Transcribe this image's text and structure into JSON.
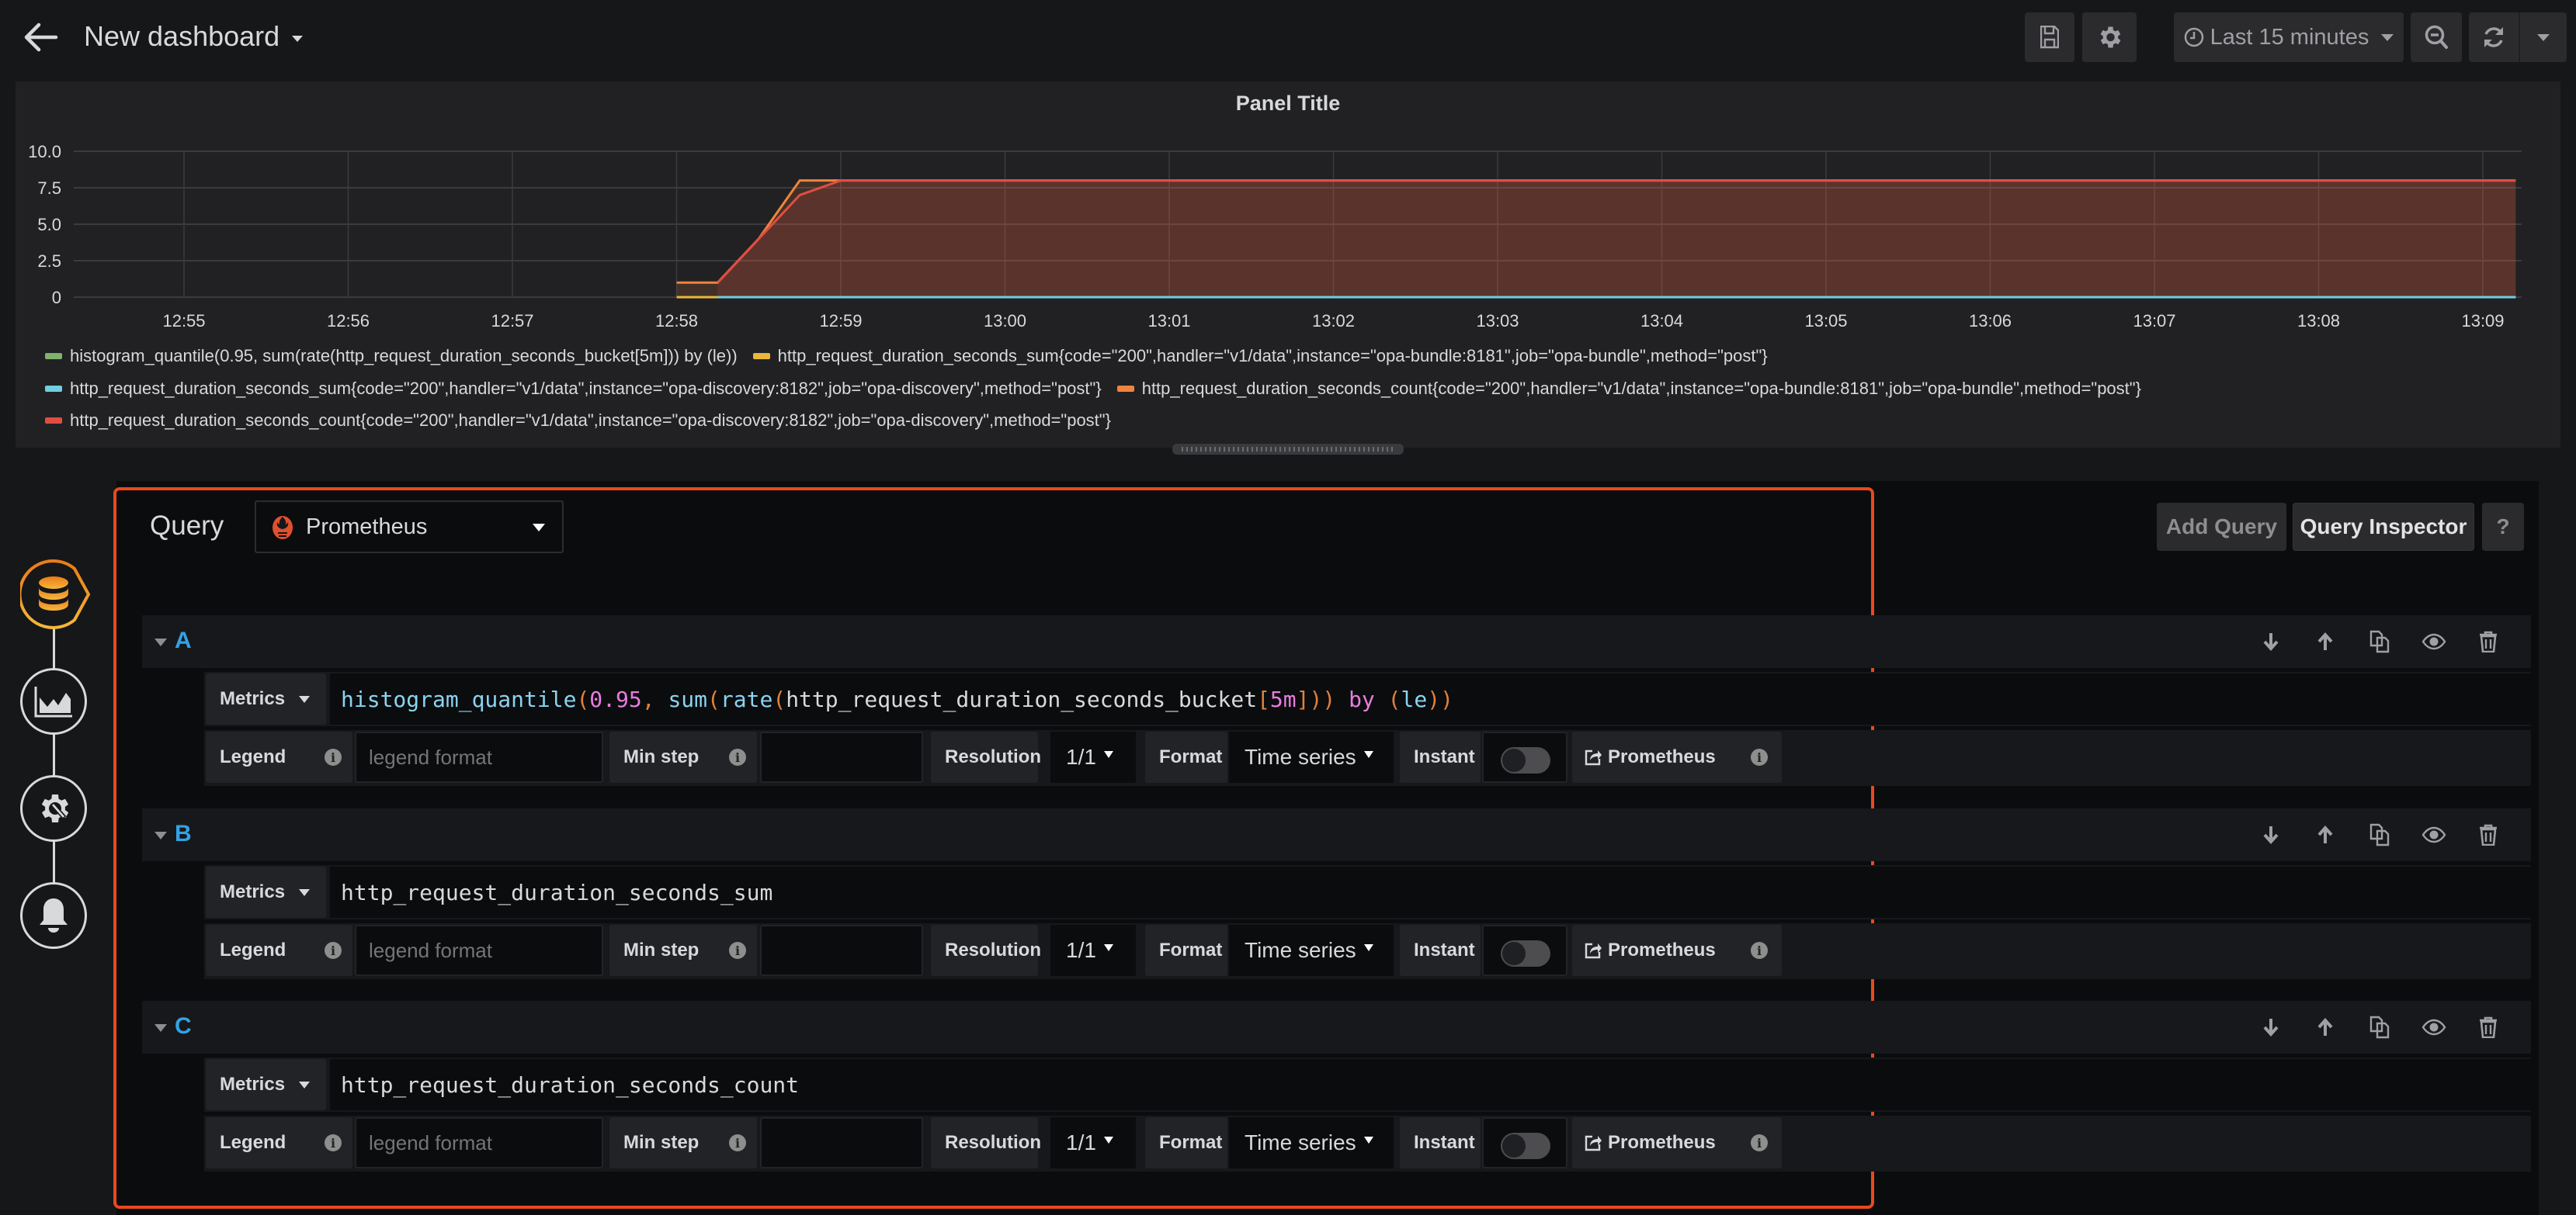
{
  "header": {
    "title": "New dashboard",
    "time_range": "Last 15 minutes",
    "icons": {
      "back": "arrow-left-icon",
      "save": "save-icon",
      "settings": "gear-icon",
      "clock": "clock-icon",
      "zoom_out": "zoom-out-icon",
      "refresh": "refresh-icon",
      "refresh_dropdown": "caret-down-icon"
    }
  },
  "panel": {
    "title": "Panel Title"
  },
  "chart_data": {
    "type": "line",
    "title": "Panel Title",
    "xlabel": "",
    "ylabel": "",
    "ylim": [
      0,
      10
    ],
    "yticks": [
      "0",
      "2.5",
      "5.0",
      "7.5",
      "10.0"
    ],
    "ytick_values": [
      0,
      2.5,
      5,
      7.5,
      10
    ],
    "xticks": [
      "12:55",
      "12:56",
      "12:57",
      "12:58",
      "12:59",
      "13:00",
      "13:01",
      "13:02",
      "13:03",
      "13:04",
      "13:05",
      "13:06",
      "13:07",
      "13:08",
      "13:09"
    ],
    "x_unit": "minutes since 12:55",
    "xlim": [
      -0.67,
      14.3
    ],
    "grid": true,
    "legend_position": "bottom",
    "series": [
      {
        "name": "histogram_quantile(0.95, sum(rate(http_request_duration_seconds_bucket[5m])) by (le))",
        "color": "#7eb26d",
        "x": [
          3.0,
          14.2
        ],
        "y": [
          0,
          0
        ],
        "fill": false
      },
      {
        "name": "http_request_duration_seconds_sum{code=\"200\",handler=\"v1/data\",instance=\"opa-bundle:8181\",job=\"opa-bundle\",method=\"post\"}",
        "color": "#eab839",
        "x": [
          3.0,
          3.25,
          14.2
        ],
        "y": [
          0,
          0,
          0
        ],
        "fill": false
      },
      {
        "name": "http_request_duration_seconds_sum{code=\"200\",handler=\"v1/data\",instance=\"opa-discovery:8182\",job=\"opa-discovery\",method=\"post\"}",
        "color": "#6ed0e0",
        "x": [
          3.25,
          14.2
        ],
        "y": [
          0,
          0
        ],
        "fill": false
      },
      {
        "name": "http_request_duration_seconds_count{code=\"200\",handler=\"v1/data\",instance=\"opa-bundle:8181\",job=\"opa-bundle\",method=\"post\"}",
        "color": "#ef843c",
        "x": [
          3.0,
          3.25,
          3.5,
          3.75,
          4.0,
          14.2
        ],
        "y": [
          1,
          1,
          4,
          8,
          8,
          8
        ],
        "fill": true
      },
      {
        "name": "http_request_duration_seconds_count{code=\"200\",handler=\"v1/data\",instance=\"opa-discovery:8182\",job=\"opa-discovery\",method=\"post\"}",
        "color": "#e24d42",
        "x": [
          3.25,
          3.5,
          3.75,
          4.0,
          14.2
        ],
        "y": [
          1,
          4,
          7,
          8,
          8
        ],
        "fill": true
      }
    ]
  },
  "legend": {
    "rows": [
      [
        0,
        1
      ],
      [
        2,
        3
      ],
      [
        4
      ]
    ]
  },
  "editor": {
    "query_label": "Query",
    "datasource": "Prometheus",
    "add_query": "Add Query",
    "query_inspector": "Query Inspector",
    "help": "?",
    "rail": [
      "database-icon",
      "chart-area-icon",
      "settings-wrench-icon",
      "bell-icon"
    ],
    "queries": [
      {
        "ref_id": "A",
        "metrics_label": "Metrics",
        "expr": "histogram_quantile(0.95, sum(rate(http_request_duration_seconds_bucket[5m])) by (le))",
        "tokens": [
          {
            "t": "histogram_quantile",
            "c": "fn"
          },
          {
            "t": "(",
            "c": "par"
          },
          {
            "t": "0.95",
            "c": "num"
          },
          {
            "t": ", ",
            "c": "par"
          },
          {
            "t": "sum",
            "c": "fn"
          },
          {
            "t": "(",
            "c": "par"
          },
          {
            "t": "rate",
            "c": "fn"
          },
          {
            "t": "(",
            "c": "par"
          },
          {
            "t": "http_request_duration_seconds_bucket",
            "c": "id"
          },
          {
            "t": "[",
            "c": "par"
          },
          {
            "t": "5m",
            "c": "num"
          },
          {
            "t": "]",
            "c": "par"
          },
          {
            "t": "))",
            "c": "par"
          },
          {
            "t": " by ",
            "c": "kw"
          },
          {
            "t": "(",
            "c": "par"
          },
          {
            "t": "le",
            "c": "fn"
          },
          {
            "t": "))",
            "c": "par"
          }
        ],
        "legend_label": "Legend",
        "legend_placeholder": "legend format",
        "legend_value": "",
        "min_step_label": "Min step",
        "min_step_value": "",
        "resolution_label": "Resolution",
        "resolution": "1/1",
        "format_label": "Format",
        "format": "Time series",
        "instant_label": "Instant",
        "instant": false,
        "link_label": "Prometheus"
      },
      {
        "ref_id": "B",
        "metrics_label": "Metrics",
        "expr": "http_request_duration_seconds_sum",
        "tokens": [
          {
            "t": "http_request_duration_seconds_sum",
            "c": "id"
          }
        ],
        "legend_label": "Legend",
        "legend_placeholder": "legend format",
        "legend_value": "",
        "min_step_label": "Min step",
        "min_step_value": "",
        "resolution_label": "Resolution",
        "resolution": "1/1",
        "format_label": "Format",
        "format": "Time series",
        "instant_label": "Instant",
        "instant": false,
        "link_label": "Prometheus"
      },
      {
        "ref_id": "C",
        "metrics_label": "Metrics",
        "expr": "http_request_duration_seconds_count",
        "tokens": [
          {
            "t": "http_request_duration_seconds_count",
            "c": "id"
          }
        ],
        "legend_label": "Legend",
        "legend_placeholder": "legend format",
        "legend_value": "",
        "min_step_label": "Min step",
        "min_step_value": "",
        "resolution_label": "Resolution",
        "resolution": "1/1",
        "format_label": "Format",
        "format": "Time series",
        "instant_label": "Instant",
        "instant": false,
        "link_label": "Prometheus"
      }
    ]
  }
}
